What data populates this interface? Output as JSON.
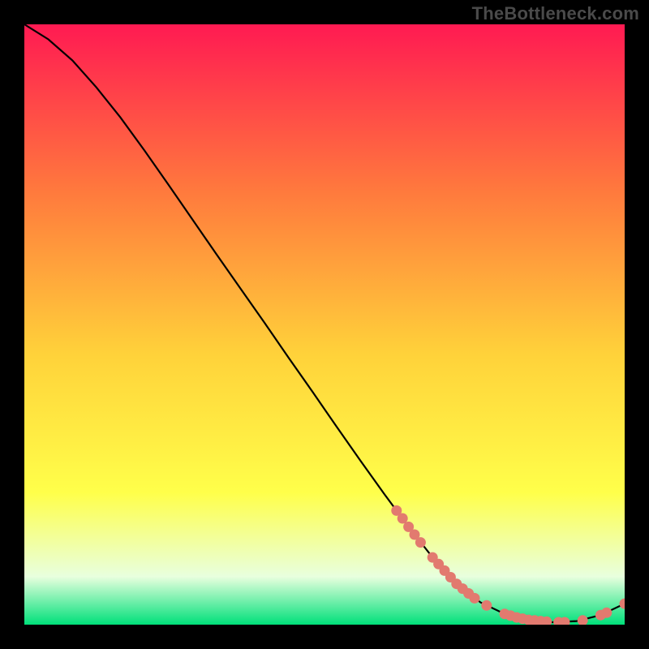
{
  "watermark": "TheBottleneck.com",
  "colors": {
    "background": "#000000",
    "gradient_top": "#ff1a52",
    "gradient_mid_top": "#ff7a3d",
    "gradient_mid": "#ffd23a",
    "gradient_mid_low": "#ffff4a",
    "gradient_low": "#e8ffde",
    "gradient_bottom": "#00e07a",
    "curve": "#000000",
    "marker_fill": "#e27a6f",
    "marker_stroke": "#d85e52"
  },
  "chart_data": {
    "type": "line",
    "title": "",
    "xlabel": "",
    "ylabel": "",
    "xlim": [
      0,
      100
    ],
    "ylim": [
      0,
      100
    ],
    "series": [
      {
        "name": "bottleneck-curve",
        "x": [
          0,
          4,
          8,
          12,
          16,
          20,
          24,
          28,
          32,
          36,
          40,
          44,
          48,
          52,
          56,
          60,
          64,
          68,
          72,
          76,
          80,
          84,
          88,
          92,
          96,
          100
        ],
        "y": [
          100,
          97.5,
          94,
          89.5,
          84.5,
          79,
          73.3,
          67.5,
          61.7,
          56,
          50.3,
          44.5,
          38.8,
          33,
          27.3,
          21.7,
          16.3,
          11.2,
          6.8,
          3.7,
          1.8,
          0.8,
          0.4,
          0.6,
          1.6,
          3.5
        ]
      }
    ],
    "markers": {
      "name": "highlighted-points",
      "x": [
        62,
        63,
        64,
        65,
        66,
        68,
        69,
        70,
        71,
        72,
        73,
        74,
        75,
        77,
        80,
        81,
        82,
        83,
        84,
        85,
        86,
        87,
        89,
        90,
        93,
        96,
        97,
        100
      ],
      "y": [
        19.0,
        17.7,
        16.3,
        15.0,
        13.7,
        11.2,
        10.1,
        9.0,
        7.9,
        6.8,
        6.0,
        5.2,
        4.4,
        3.2,
        1.8,
        1.5,
        1.2,
        1.0,
        0.8,
        0.7,
        0.6,
        0.5,
        0.4,
        0.4,
        0.7,
        1.6,
        2.0,
        3.5
      ]
    }
  }
}
